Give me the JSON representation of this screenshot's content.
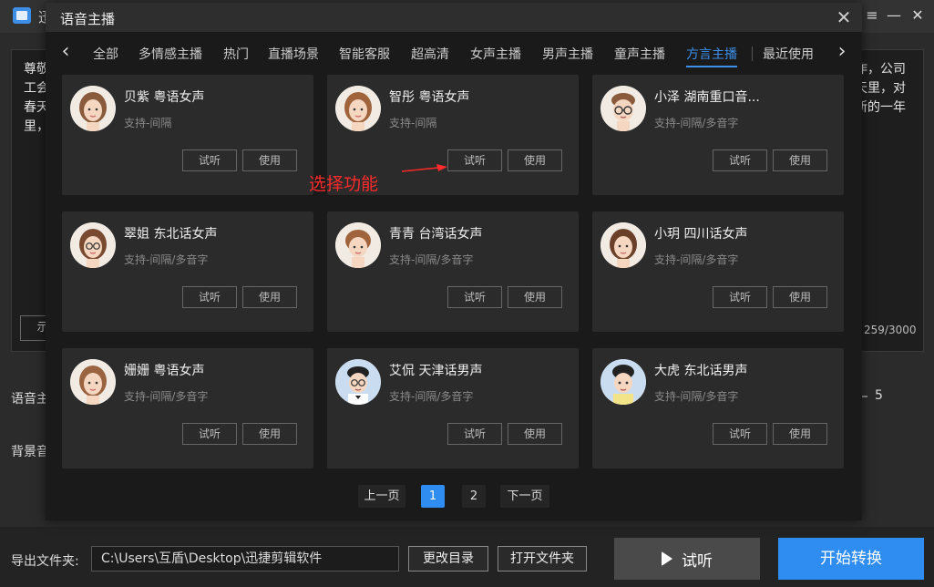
{
  "background": {
    "title_fragment": "迅",
    "window_controls": [
      "≡",
      "—",
      "✕"
    ],
    "editor_left_lines": [
      "尊敬",
      "工会",
      "春天",
      "里，"
    ],
    "editor_right_lines": [
      "作，公司",
      "天里，对",
      "新的一年"
    ],
    "left_button_fragment": "示",
    "char_count": "259/3000",
    "label_voice": "语音主",
    "label_music": "背景音",
    "speed_value": "5",
    "export_label": "导出文件夹:",
    "export_path": "C:\\Users\\互盾\\Desktop\\迅捷剪辑软件",
    "change_dir": "更改目录",
    "open_folder": "打开文件夹",
    "preview": "试听",
    "start": "开始转换"
  },
  "dialog": {
    "title": "语音主播",
    "tabs": [
      "全部",
      "多情感主播",
      "热门",
      "直播场景",
      "智能客服",
      "超高清",
      "女声主播",
      "男声主播",
      "童声主播",
      "方言主播",
      "最近使用"
    ],
    "active_tab": "方言主播",
    "cards": [
      {
        "name": "贝紫 粤语女声",
        "sub": "支持-间隔",
        "avatar": "female-avatar",
        "try": "试听",
        "use": "使用"
      },
      {
        "name": "智彤 粤语女声",
        "sub": "支持-间隔",
        "avatar": "female-avatar",
        "try": "试听",
        "use": "使用"
      },
      {
        "name": "小泽 湖南重口音...",
        "sub": "支持-间隔/多音字",
        "avatar": "male-glasses-avatar",
        "try": "试听",
        "use": "使用"
      },
      {
        "name": "翠姐 东北话女声",
        "sub": "支持-间隔/多音字",
        "avatar": "female-glasses-avatar",
        "try": "试听",
        "use": "使用"
      },
      {
        "name": "青青 台湾话女声",
        "sub": "支持-间隔/多音字",
        "avatar": "female-short-avatar",
        "try": "试听",
        "use": "使用"
      },
      {
        "name": "小玥 四川话女声",
        "sub": "支持-间隔/多音字",
        "avatar": "female-avatar",
        "try": "试听",
        "use": "使用"
      },
      {
        "name": "姗姗 粤语女声",
        "sub": "支持-间隔/多音字",
        "avatar": "female-avatar",
        "try": "试听",
        "use": "使用"
      },
      {
        "name": "艾侃 天津话男声",
        "sub": "支持-间隔/多音字",
        "avatar": "male-glasses-avatar",
        "try": "试听",
        "use": "使用"
      },
      {
        "name": "大虎 东北话男声",
        "sub": "支持-间隔/多音字",
        "avatar": "male-avatar",
        "try": "试听",
        "use": "使用"
      }
    ],
    "annotation": "选择功能",
    "pagination": {
      "prev": "上一页",
      "pages": [
        "1",
        "2"
      ],
      "current": "1",
      "next": "下一页"
    }
  }
}
